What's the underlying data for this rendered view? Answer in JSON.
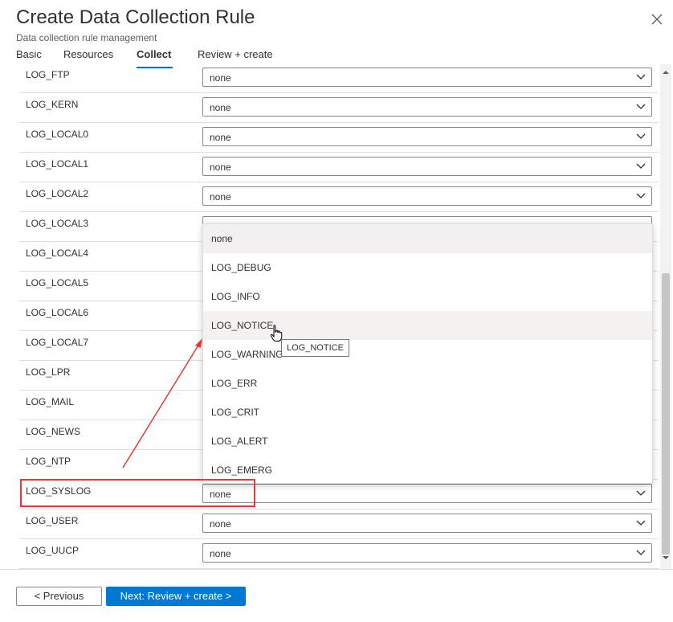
{
  "header": {
    "title": "Create Data Collection Rule",
    "subtitle": "Data collection rule management"
  },
  "tabs": [
    {
      "label": "Basic"
    },
    {
      "label": "Resources"
    },
    {
      "label": "Collect",
      "active": true
    },
    {
      "label": "Review + create"
    }
  ],
  "rows": [
    {
      "label": "LOG_FTP",
      "value": "none"
    },
    {
      "label": "LOG_KERN",
      "value": "none"
    },
    {
      "label": "LOG_LOCAL0",
      "value": "none"
    },
    {
      "label": "LOG_LOCAL1",
      "value": "none"
    },
    {
      "label": "LOG_LOCAL2",
      "value": "none"
    },
    {
      "label": "LOG_LOCAL3",
      "value": ""
    },
    {
      "label": "LOG_LOCAL4",
      "value": ""
    },
    {
      "label": "LOG_LOCAL5",
      "value": ""
    },
    {
      "label": "LOG_LOCAL6",
      "value": ""
    },
    {
      "label": "LOG_LOCAL7",
      "value": ""
    },
    {
      "label": "LOG_LPR",
      "value": ""
    },
    {
      "label": "LOG_MAIL",
      "value": ""
    },
    {
      "label": "LOG_NEWS",
      "value": ""
    },
    {
      "label": "LOG_NTP",
      "value": ""
    },
    {
      "label": "LOG_SYSLOG",
      "value": "none"
    },
    {
      "label": "LOG_USER",
      "value": "none"
    },
    {
      "label": "LOG_UUCP",
      "value": "none"
    }
  ],
  "dropdown": {
    "options": [
      "none",
      "LOG_DEBUG",
      "LOG_INFO",
      "LOG_NOTICE",
      "LOG_WARNING",
      "LOG_ERR",
      "LOG_CRIT",
      "LOG_ALERT",
      "LOG_EMERG"
    ],
    "selected": "none",
    "hovered": "LOG_NOTICE"
  },
  "tooltip": "LOG_NOTICE",
  "footer": {
    "previous_label": "< Previous",
    "next_label": "Next: Review + create >"
  },
  "colors": {
    "accent": "#0078d4",
    "annotation": "#e53935"
  },
  "icons": {
    "close": "close-icon",
    "chevron": "chevron-down-icon",
    "cursor": "hand-pointer-icon"
  }
}
